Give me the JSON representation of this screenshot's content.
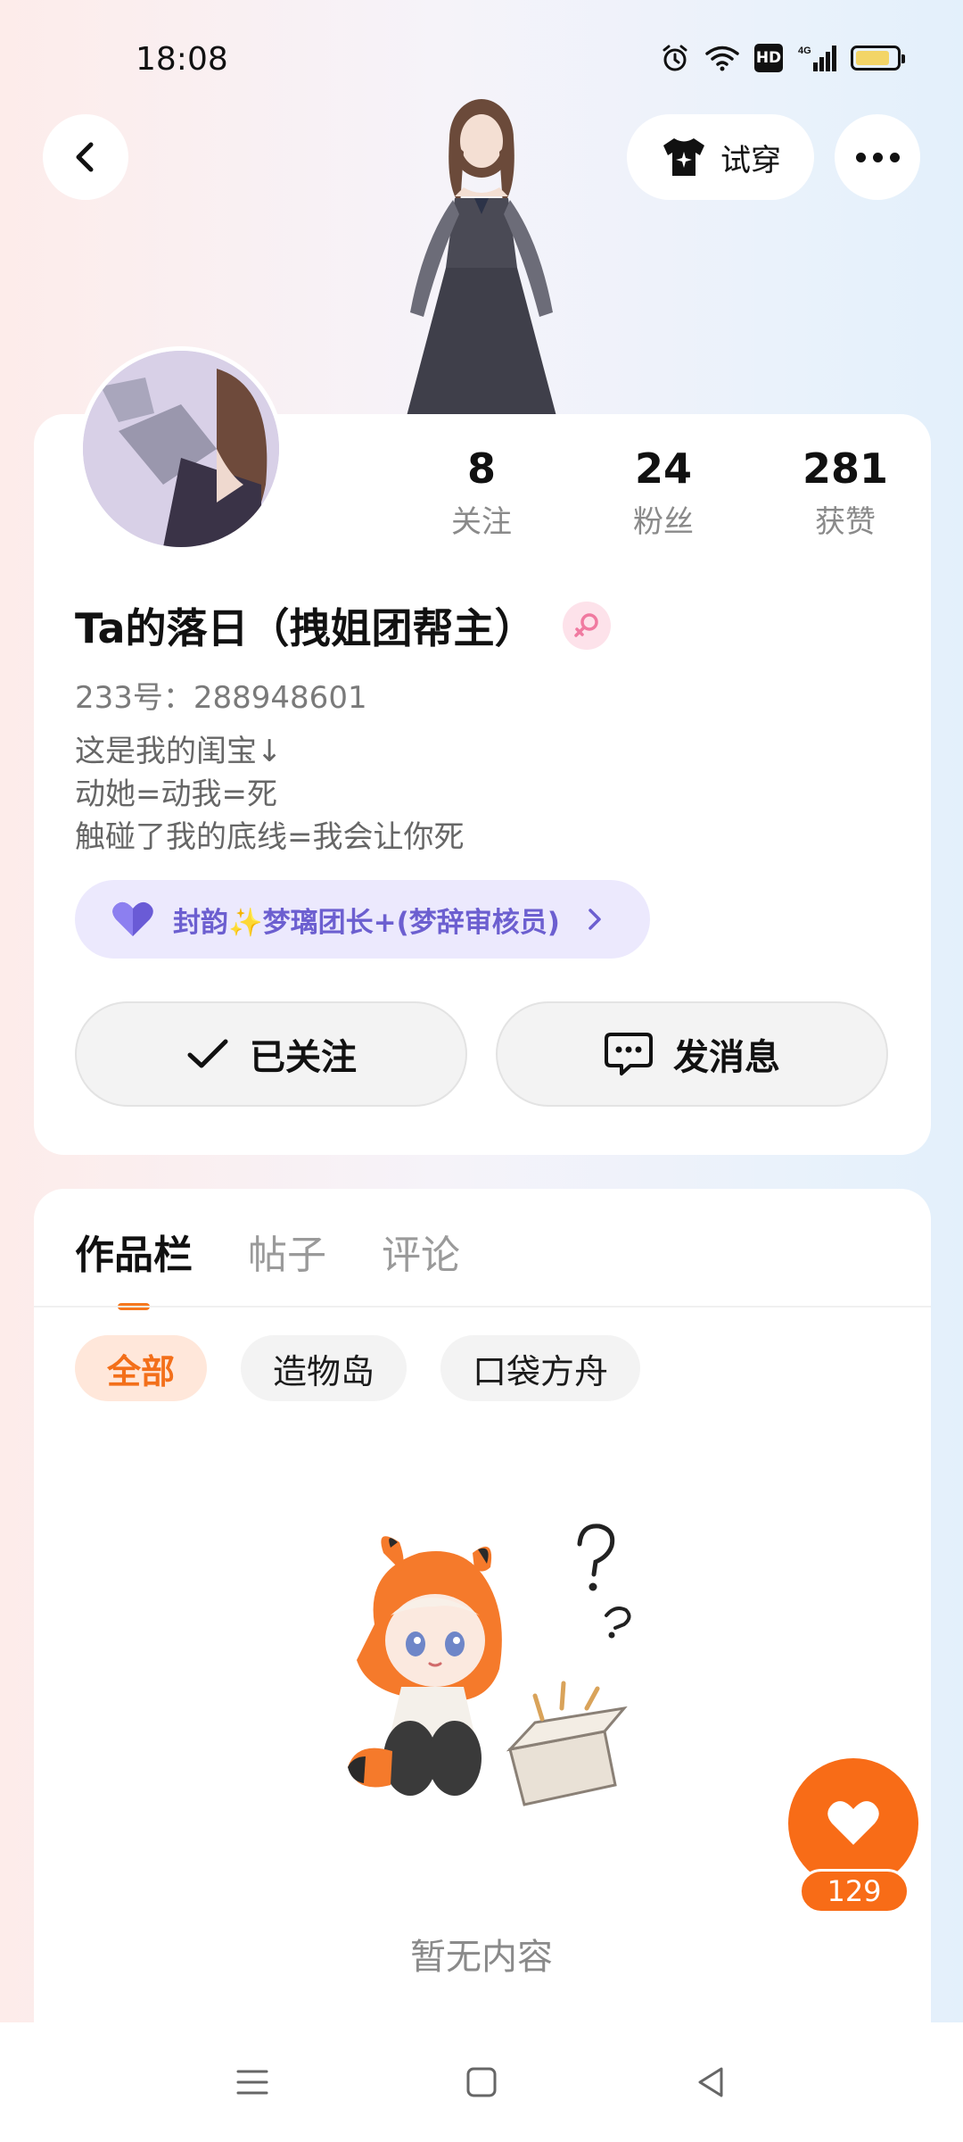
{
  "status_bar": {
    "time": "18:08",
    "hd_label": "HD",
    "battery_level": 0.85
  },
  "header": {
    "tryon_label": "试穿"
  },
  "profile": {
    "stats": [
      {
        "value": "8",
        "label": "关注"
      },
      {
        "value": "24",
        "label": "粉丝"
      },
      {
        "value": "281",
        "label": "获赞"
      }
    ],
    "username": "Ta的落日（拽姐团帮主）",
    "uid": "233号：288948601",
    "bio": [
      "这是我的闺宝↓",
      "动她=动我=死",
      "触碰了我的底线=我会让你死"
    ],
    "group_label": "封韵✨梦璃团长+(梦辞审核员)",
    "follow_label": "已关注",
    "message_label": "发消息"
  },
  "content": {
    "tabs": [
      {
        "label": "作品栏",
        "active": true
      },
      {
        "label": "帖子",
        "active": false
      },
      {
        "label": "评论",
        "active": false
      }
    ],
    "filters": [
      {
        "label": "全部",
        "active": true
      },
      {
        "label": "造物岛",
        "active": false
      },
      {
        "label": "口袋方舟",
        "active": false
      }
    ],
    "empty_text": "暂无内容"
  },
  "like_fab": {
    "count": "129"
  },
  "colors": {
    "accent": "#f86c17",
    "group_text": "#6c5fd0",
    "group_bg": "#ece9fd",
    "gender": "#f07aa0"
  }
}
